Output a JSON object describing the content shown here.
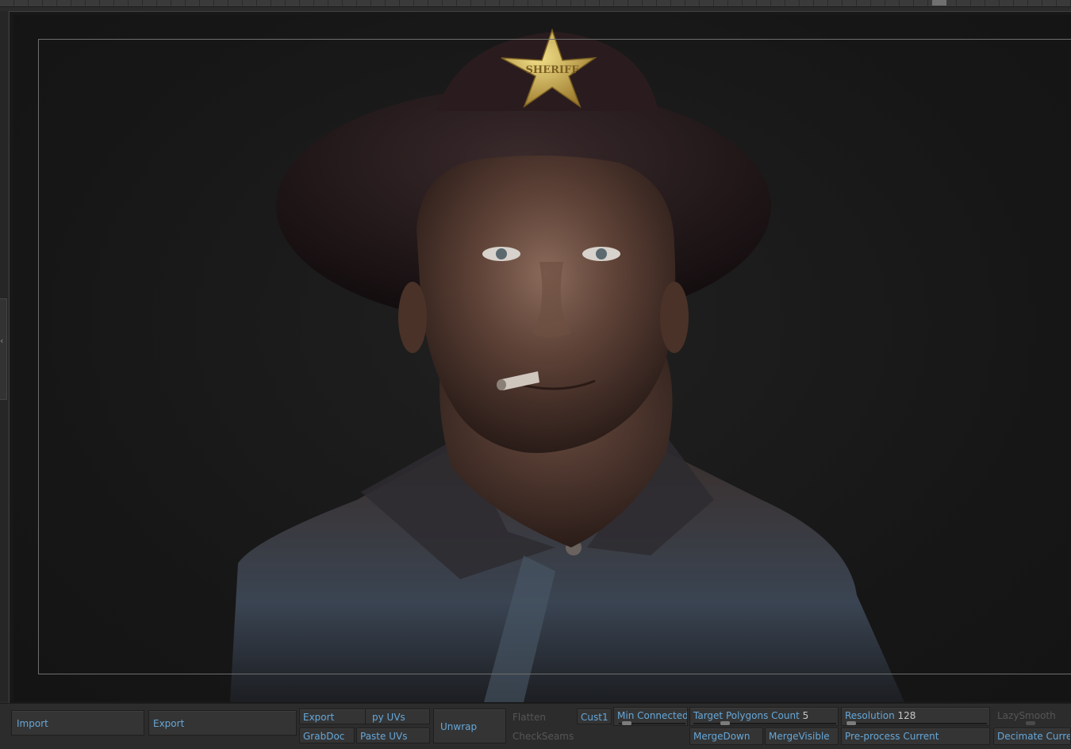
{
  "toolbar": {
    "import": "Import",
    "export_main": "Export",
    "export_small": "Export",
    "copy_uvs": "py UVs",
    "grabdoc": "GrabDoc",
    "paste_uvs": "Paste UVs",
    "unwrap": "Unwrap",
    "flatten": "Flatten",
    "checkseams": "CheckSeams",
    "cust1": "Cust1",
    "min_connected": "Min Connected F",
    "target_polygons_label": "Target Polygons Count",
    "target_polygons_value": "5",
    "mergedown": "MergeDown",
    "mergevisible": "MergeVisible",
    "resolution_label": "Resolution",
    "resolution_value": "128",
    "preprocess": "Pre-process Current",
    "lazysmooth": "LazySmooth",
    "decimate": "Decimate Curren"
  },
  "sculpt": {
    "badge_text": "SHERIFF"
  },
  "colors": {
    "accent_text": "#66a7d8",
    "dim_text": "#565656",
    "value_text": "#c8c8c8",
    "panel_bg": "#2c2c2c",
    "canvas_bg": "#181818"
  }
}
